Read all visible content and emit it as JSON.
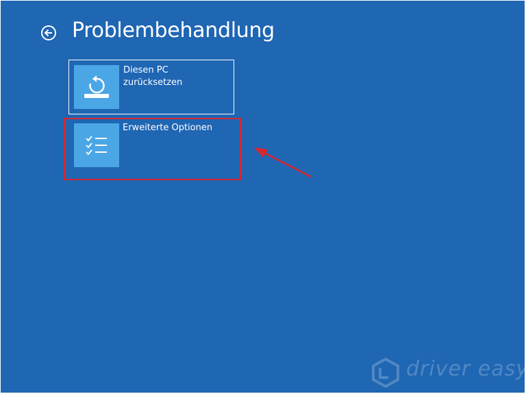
{
  "page": {
    "title": "Problembehandlung"
  },
  "tiles": [
    {
      "label_line1": "Diesen PC",
      "label_line2": "zurücksetzen",
      "icon": "reset-pc-icon"
    },
    {
      "label_line1": "Erweiterte Optionen",
      "icon": "checklist-icon"
    }
  ],
  "annotation": {
    "highlight_color": "#d9272e",
    "arrow_color": "#d9272e"
  },
  "watermark": {
    "text": "driver easy"
  },
  "colors": {
    "background": "#1f66b3",
    "tile_icon_bg": "#4ba6e6"
  }
}
